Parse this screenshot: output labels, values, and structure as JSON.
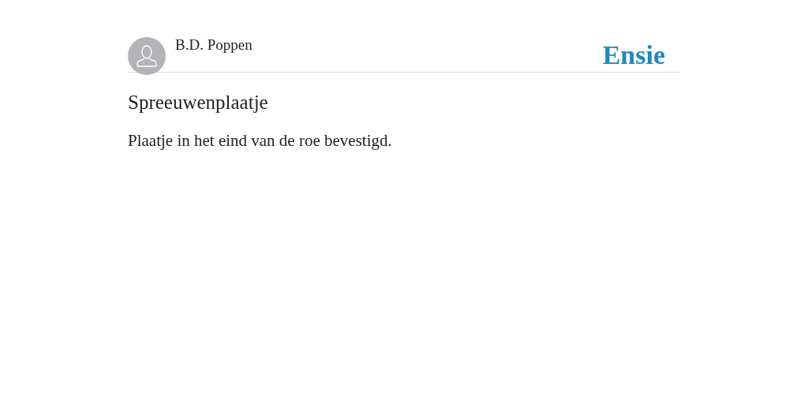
{
  "header": {
    "author": "B.D. Poppen",
    "logo": "Ensie"
  },
  "entry": {
    "title": "Spreeuwenplaatje",
    "definition": "Plaatje in het eind van de roe bevestigd."
  }
}
